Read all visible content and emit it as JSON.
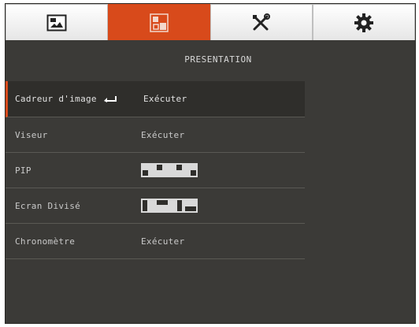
{
  "tabs": [
    {
      "name": "image",
      "icon": "image-icon",
      "active": false
    },
    {
      "name": "presentation",
      "icon": "presentation-icon",
      "active": true
    },
    {
      "name": "tools",
      "icon": "tools-icon",
      "active": false
    },
    {
      "name": "settings",
      "icon": "gear-icon",
      "active": false
    }
  ],
  "header": {
    "title": "PRESENTATION"
  },
  "colors": {
    "accent": "#d84a1b",
    "background": "#3b3a37",
    "text": "#c9c9c9"
  },
  "menu": [
    {
      "label": "Cadreur d'image",
      "value": "Exécuter",
      "selected": true,
      "icon": "enter-icon"
    },
    {
      "label": "Viseur",
      "value": "Exécuter"
    },
    {
      "label": "PIP",
      "options": [
        "pip-bottom-left",
        "pip-top-left",
        "pip-top-right",
        "pip-bottom-right"
      ]
    },
    {
      "label": "Ecran Divisé",
      "options": [
        "split-left",
        "split-top",
        "split-right",
        "split-bottom"
      ]
    },
    {
      "label": "Chronomètre",
      "value": "Exécuter"
    }
  ]
}
